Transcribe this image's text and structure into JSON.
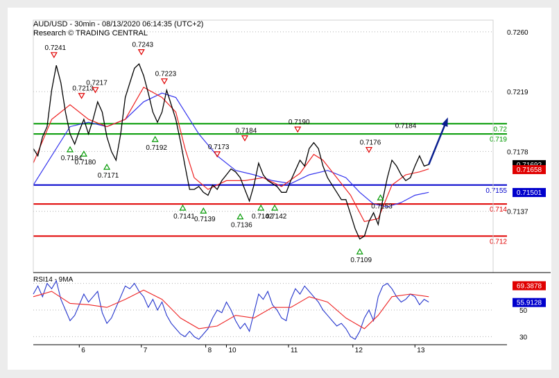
{
  "chart_data": {
    "type": "line",
    "header": {
      "title": "AUD/USD - 30min - 08/13/2020 06:14:35 (UTC+2)",
      "subtitle": "Research © TRADING CENTRAL"
    },
    "price_axis": {
      "ylim": [
        0.7095,
        0.7268
      ],
      "ticks": [
        "0.7260",
        "0.7219",
        "0.7178",
        "0.7137"
      ]
    },
    "x_axis": {
      "ticks": [
        "6",
        "7",
        "8",
        "10",
        "11",
        "12",
        "13"
      ]
    },
    "levels": [
      {
        "value": 0.7197,
        "label": "0.72",
        "color": "#009900",
        "text_color": "#009900"
      },
      {
        "value": 0.719,
        "label": "0.719",
        "color": "#009900",
        "text_color": "#009900"
      },
      {
        "value": 0.7155,
        "label": "0.7155",
        "color": "#0000cc",
        "text_color": "#0000cc"
      },
      {
        "value": 0.7142,
        "label": "0.714",
        "color": "#e00000",
        "text_color": "#e00000"
      },
      {
        "value": 0.712,
        "label": "0.712",
        "color": "#e00000",
        "text_color": "#e00000"
      }
    ],
    "current_price_badges": [
      {
        "value": "0.71692",
        "bg": "#000000",
        "fg": "#ffffff",
        "y": 0.71692
      },
      {
        "value": "0.71658",
        "bg": "#e00000",
        "fg": "#ffffff",
        "y": 0.71658
      },
      {
        "value": "0.71501",
        "bg": "#0000cc",
        "fg": "#ffffff",
        "y": 0.71501
      }
    ],
    "x_domain": [
      0,
      100
    ],
    "tick_positions": [
      10,
      23.5,
      37.5,
      42,
      55.5,
      69.5,
      83
    ],
    "price_series": [
      [
        0,
        0.718
      ],
      [
        1,
        0.7175
      ],
      [
        2,
        0.7188
      ],
      [
        3,
        0.7195
      ],
      [
        4,
        0.722
      ],
      [
        5,
        0.7237
      ],
      [
        6,
        0.7225
      ],
      [
        7,
        0.7205
      ],
      [
        8,
        0.719
      ],
      [
        9,
        0.7183
      ],
      [
        10,
        0.7192
      ],
      [
        11,
        0.72
      ],
      [
        12,
        0.719
      ],
      [
        13,
        0.72
      ],
      [
        14,
        0.7212
      ],
      [
        15,
        0.7205
      ],
      [
        16,
        0.7188
      ],
      [
        17,
        0.7178
      ],
      [
        18,
        0.7172
      ],
      [
        19,
        0.719
      ],
      [
        20,
        0.7215
      ],
      [
        21,
        0.7225
      ],
      [
        22,
        0.7235
      ],
      [
        23,
        0.7238
      ],
      [
        24,
        0.723
      ],
      [
        25,
        0.7218
      ],
      [
        26,
        0.7205
      ],
      [
        27,
        0.7198
      ],
      [
        28,
        0.7205
      ],
      [
        29,
        0.722
      ],
      [
        30,
        0.721
      ],
      [
        31,
        0.72
      ],
      [
        32,
        0.7185
      ],
      [
        33,
        0.7168
      ],
      [
        34,
        0.7152
      ],
      [
        35,
        0.7152
      ],
      [
        36,
        0.7154
      ],
      [
        37,
        0.715
      ],
      [
        38,
        0.7148
      ],
      [
        39,
        0.7155
      ],
      [
        40,
        0.7152
      ],
      [
        41,
        0.7158
      ],
      [
        42,
        0.7162
      ],
      [
        43,
        0.7166
      ],
      [
        44,
        0.7164
      ],
      [
        45,
        0.716
      ],
      [
        46,
        0.7152
      ],
      [
        47,
        0.7144
      ],
      [
        48,
        0.7155
      ],
      [
        49,
        0.717
      ],
      [
        50,
        0.7162
      ],
      [
        51,
        0.7158
      ],
      [
        52,
        0.7156
      ],
      [
        53,
        0.7154
      ],
      [
        54,
        0.715
      ],
      [
        55,
        0.715
      ],
      [
        56,
        0.7158
      ],
      [
        57,
        0.7165
      ],
      [
        58,
        0.7172
      ],
      [
        59,
        0.7168
      ],
      [
        60,
        0.718
      ],
      [
        61,
        0.7184
      ],
      [
        62,
        0.718
      ],
      [
        63,
        0.7168
      ],
      [
        64,
        0.716
      ],
      [
        65,
        0.7155
      ],
      [
        66,
        0.715
      ],
      [
        67,
        0.7145
      ],
      [
        68,
        0.7145
      ],
      [
        69,
        0.7135
      ],
      [
        70,
        0.7125
      ],
      [
        71,
        0.7118
      ],
      [
        72,
        0.712
      ],
      [
        73,
        0.713
      ],
      [
        74,
        0.7136
      ],
      [
        75,
        0.7128
      ],
      [
        76,
        0.7145
      ],
      [
        77,
        0.716
      ],
      [
        78,
        0.7172
      ],
      [
        79,
        0.7168
      ],
      [
        80,
        0.7162
      ],
      [
        81,
        0.7158
      ],
      [
        82,
        0.716
      ],
      [
        83,
        0.7168
      ],
      [
        84,
        0.7175
      ],
      [
        85,
        0.7168
      ],
      [
        86,
        0.7169
      ]
    ],
    "ma_red": [
      [
        0,
        0.717
      ],
      [
        4,
        0.72
      ],
      [
        8,
        0.721
      ],
      [
        12,
        0.72
      ],
      [
        16,
        0.7195
      ],
      [
        20,
        0.72
      ],
      [
        24,
        0.7222
      ],
      [
        28,
        0.7215
      ],
      [
        31,
        0.7205
      ],
      [
        33,
        0.718
      ],
      [
        35,
        0.716
      ],
      [
        38,
        0.7152
      ],
      [
        42,
        0.7158
      ],
      [
        46,
        0.7158
      ],
      [
        50,
        0.716
      ],
      [
        54,
        0.7154
      ],
      [
        58,
        0.7163
      ],
      [
        61,
        0.7176
      ],
      [
        63,
        0.7172
      ],
      [
        66,
        0.716
      ],
      [
        69,
        0.7148
      ],
      [
        72,
        0.713
      ],
      [
        75,
        0.7132
      ],
      [
        78,
        0.7155
      ],
      [
        81,
        0.7162
      ],
      [
        84,
        0.7164
      ],
      [
        86,
        0.7166
      ]
    ],
    "ma_blue": [
      [
        0,
        0.7155
      ],
      [
        4,
        0.7175
      ],
      [
        8,
        0.7195
      ],
      [
        12,
        0.7198
      ],
      [
        16,
        0.7195
      ],
      [
        20,
        0.72
      ],
      [
        24,
        0.7212
      ],
      [
        28,
        0.7218
      ],
      [
        31,
        0.7215
      ],
      [
        33,
        0.7205
      ],
      [
        36,
        0.719
      ],
      [
        40,
        0.7175
      ],
      [
        44,
        0.7165
      ],
      [
        48,
        0.7162
      ],
      [
        52,
        0.7158
      ],
      [
        56,
        0.7156
      ],
      [
        60,
        0.7162
      ],
      [
        64,
        0.7165
      ],
      [
        68,
        0.716
      ],
      [
        71,
        0.715
      ],
      [
        74,
        0.7142
      ],
      [
        77,
        0.714
      ],
      [
        80,
        0.7143
      ],
      [
        83,
        0.7148
      ],
      [
        86,
        0.715
      ]
    ],
    "forecast_arrow": {
      "from": [
        86,
        0.7169
      ],
      "to": [
        90,
        0.72
      ]
    },
    "annotations": [
      {
        "label": "0.7241",
        "x": 4.5,
        "y": 0.7241,
        "kind": "top"
      },
      {
        "label": "0.7243",
        "x": 23.5,
        "y": 0.7243,
        "kind": "top"
      },
      {
        "label": "0.7213",
        "x": 10.5,
        "y": 0.7213,
        "kind": "top"
      },
      {
        "label": "0.7217",
        "x": 13.5,
        "y": 0.7217,
        "kind": "top"
      },
      {
        "label": "0.7223",
        "x": 28.5,
        "y": 0.7223,
        "kind": "top"
      },
      {
        "label": "0.7184",
        "x": 8,
        "y": 0.7183,
        "kind": "bottom"
      },
      {
        "label": "0.7180",
        "x": 11,
        "y": 0.718,
        "kind": "bottom"
      },
      {
        "label": "0.7171",
        "x": 16,
        "y": 0.7171,
        "kind": "bottom"
      },
      {
        "label": "0.7192",
        "x": 26.5,
        "y": 0.719,
        "kind": "bottom"
      },
      {
        "label": "0.7141",
        "x": 32.5,
        "y": 0.7143,
        "kind": "bottom"
      },
      {
        "label": "0.7139",
        "x": 37,
        "y": 0.7141,
        "kind": "bottom"
      },
      {
        "label": "0.7173",
        "x": 40,
        "y": 0.7173,
        "kind": "top"
      },
      {
        "label": "0.7184",
        "x": 46,
        "y": 0.7184,
        "kind": "top"
      },
      {
        "label": "0.7136",
        "x": 45,
        "y": 0.7137,
        "kind": "bottom"
      },
      {
        "label": "0.7142",
        "x": 49.5,
        "y": 0.7143,
        "kind": "bottom"
      },
      {
        "label": "0.7142",
        "x": 52.5,
        "y": 0.7143,
        "kind": "bottom"
      },
      {
        "label": "0.7190",
        "x": 57.5,
        "y": 0.719,
        "kind": "top"
      },
      {
        "label": "0.7109",
        "x": 71,
        "y": 0.7113,
        "kind": "bottom"
      },
      {
        "label": "0.7176",
        "x": 73,
        "y": 0.7176,
        "kind": "top"
      },
      {
        "label": "0.7153",
        "x": 75.5,
        "y": 0.715,
        "kind": "bottom"
      },
      {
        "label": "0.7184",
        "x": 81,
        "y": 0.7194,
        "kind": "plain"
      }
    ],
    "rsi": {
      "title": "RSI14 - 9MA",
      "ylim": [
        25,
        75
      ],
      "ticks": [
        "70",
        "50",
        "30"
      ],
      "badges": [
        {
          "value": "69.3878",
          "bg": "#e00000",
          "fg": "#ffffff",
          "y": 68.5
        },
        {
          "value": "55.9128",
          "bg": "#0000cc",
          "fg": "#ffffff",
          "y": 55.9
        }
      ],
      "rsi_series": [
        [
          0,
          62
        ],
        [
          1,
          68
        ],
        [
          2,
          60
        ],
        [
          3,
          70
        ],
        [
          4,
          66
        ],
        [
          5,
          72
        ],
        [
          6,
          58
        ],
        [
          7,
          50
        ],
        [
          8,
          42
        ],
        [
          9,
          46
        ],
        [
          10,
          54
        ],
        [
          11,
          62
        ],
        [
          12,
          56
        ],
        [
          13,
          60
        ],
        [
          14,
          64
        ],
        [
          15,
          48
        ],
        [
          16,
          40
        ],
        [
          17,
          44
        ],
        [
          18,
          52
        ],
        [
          19,
          60
        ],
        [
          20,
          68
        ],
        [
          21,
          66
        ],
        [
          22,
          70
        ],
        [
          23,
          64
        ],
        [
          24,
          60
        ],
        [
          25,
          52
        ],
        [
          26,
          58
        ],
        [
          27,
          50
        ],
        [
          28,
          56
        ],
        [
          29,
          46
        ],
        [
          30,
          40
        ],
        [
          31,
          36
        ],
        [
          32,
          32
        ],
        [
          33,
          30
        ],
        [
          34,
          34
        ],
        [
          35,
          30
        ],
        [
          36,
          28
        ],
        [
          37,
          32
        ],
        [
          38,
          36
        ],
        [
          39,
          44
        ],
        [
          40,
          50
        ],
        [
          41,
          48
        ],
        [
          42,
          56
        ],
        [
          43,
          50
        ],
        [
          44,
          42
        ],
        [
          45,
          36
        ],
        [
          46,
          40
        ],
        [
          47,
          34
        ],
        [
          48,
          48
        ],
        [
          49,
          62
        ],
        [
          50,
          58
        ],
        [
          51,
          64
        ],
        [
          52,
          54
        ],
        [
          53,
          50
        ],
        [
          54,
          44
        ],
        [
          55,
          42
        ],
        [
          56,
          58
        ],
        [
          57,
          66
        ],
        [
          58,
          62
        ],
        [
          59,
          68
        ],
        [
          60,
          64
        ],
        [
          61,
          60
        ],
        [
          62,
          56
        ],
        [
          63,
          50
        ],
        [
          64,
          46
        ],
        [
          65,
          42
        ],
        [
          66,
          38
        ],
        [
          67,
          40
        ],
        [
          68,
          36
        ],
        [
          69,
          30
        ],
        [
          70,
          28
        ],
        [
          71,
          34
        ],
        [
          72,
          44
        ],
        [
          73,
          50
        ],
        [
          74,
          42
        ],
        [
          75,
          60
        ],
        [
          76,
          68
        ],
        [
          77,
          70
        ],
        [
          78,
          66
        ],
        [
          79,
          60
        ],
        [
          80,
          56
        ],
        [
          81,
          58
        ],
        [
          82,
          62
        ],
        [
          83,
          60
        ],
        [
          84,
          54
        ],
        [
          85,
          58
        ],
        [
          86,
          56
        ]
      ],
      "ma_series": [
        [
          0,
          60
        ],
        [
          4,
          64
        ],
        [
          8,
          55
        ],
        [
          12,
          54
        ],
        [
          16,
          52
        ],
        [
          20,
          58
        ],
        [
          24,
          65
        ],
        [
          28,
          58
        ],
        [
          32,
          44
        ],
        [
          36,
          36
        ],
        [
          40,
          38
        ],
        [
          44,
          46
        ],
        [
          48,
          44
        ],
        [
          52,
          52
        ],
        [
          56,
          52
        ],
        [
          60,
          60
        ],
        [
          64,
          56
        ],
        [
          68,
          44
        ],
        [
          72,
          36
        ],
        [
          75,
          46
        ],
        [
          78,
          60
        ],
        [
          82,
          62
        ],
        [
          86,
          60
        ]
      ]
    }
  }
}
